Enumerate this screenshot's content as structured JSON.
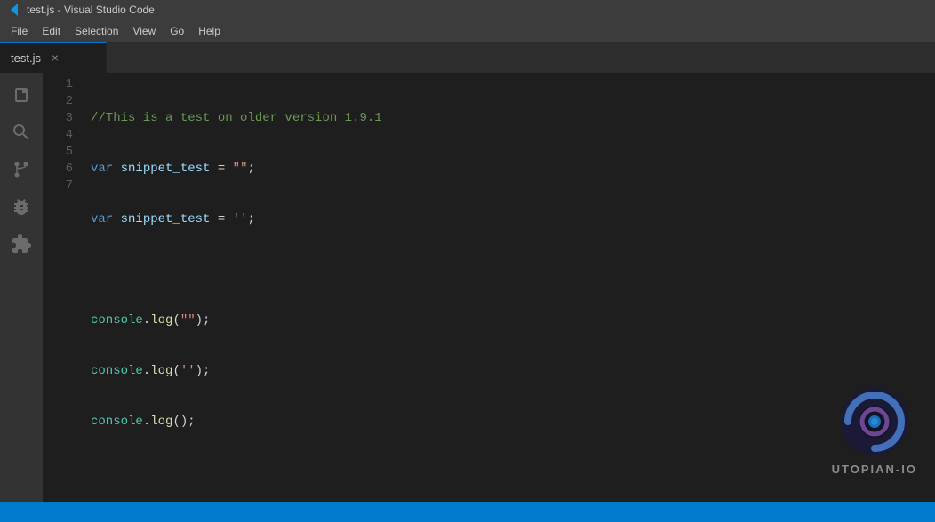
{
  "titleBar": {
    "title": "test.js - Visual Studio Code"
  },
  "menuBar": {
    "items": [
      "File",
      "Edit",
      "Selection",
      "View",
      "Go",
      "Help"
    ]
  },
  "tabs": [
    {
      "label": "test.js",
      "active": true
    }
  ],
  "activityBar": {
    "icons": [
      {
        "name": "files-icon",
        "symbol": "⎙",
        "active": false
      },
      {
        "name": "search-icon",
        "symbol": "🔍",
        "active": false
      },
      {
        "name": "source-control-icon",
        "symbol": "⎇",
        "active": false
      },
      {
        "name": "debug-icon",
        "symbol": "⬤",
        "active": false
      },
      {
        "name": "extensions-icon",
        "symbol": "⊞",
        "active": false
      }
    ]
  },
  "editor": {
    "filename": "test.js",
    "lines": [
      {
        "num": "1",
        "tokens": [
          {
            "type": "comment",
            "text": "//This is a test on older version 1.9.1"
          }
        ]
      },
      {
        "num": "2",
        "tokens": [
          {
            "type": "keyword",
            "text": "var"
          },
          {
            "type": "space",
            "text": " "
          },
          {
            "type": "variable",
            "text": "snippet_test"
          },
          {
            "type": "punct",
            "text": " = "
          },
          {
            "type": "string-dq",
            "text": "\"\""
          },
          {
            "type": "punct",
            "text": ";"
          }
        ]
      },
      {
        "num": "3",
        "tokens": [
          {
            "type": "keyword",
            "text": "var"
          },
          {
            "type": "space",
            "text": " "
          },
          {
            "type": "variable",
            "text": "snippet_test"
          },
          {
            "type": "punct",
            "text": " = "
          },
          {
            "type": "string-sq",
            "text": "''"
          },
          {
            "type": "punct",
            "text": ";"
          }
        ]
      },
      {
        "num": "4",
        "tokens": []
      },
      {
        "num": "5",
        "tokens": [
          {
            "type": "obj",
            "text": "console"
          },
          {
            "type": "punct",
            "text": "."
          },
          {
            "type": "func",
            "text": "log"
          },
          {
            "type": "punct",
            "text": "("
          },
          {
            "type": "string-dq",
            "text": "\"\""
          },
          {
            "type": "punct",
            "text": ");"
          }
        ]
      },
      {
        "num": "6",
        "tokens": [
          {
            "type": "obj",
            "text": "console"
          },
          {
            "type": "punct",
            "text": "."
          },
          {
            "type": "func",
            "text": "log"
          },
          {
            "type": "punct",
            "text": "("
          },
          {
            "type": "string-sq",
            "text": "''"
          },
          {
            "type": "punct",
            "text": ");"
          }
        ]
      },
      {
        "num": "7",
        "tokens": [
          {
            "type": "obj",
            "text": "console"
          },
          {
            "type": "punct",
            "text": "."
          },
          {
            "type": "func",
            "text": "log"
          },
          {
            "type": "punct",
            "text": "();"
          }
        ]
      }
    ]
  },
  "watermark": {
    "text": "UTOPIAN-IO"
  },
  "statusBar": {
    "text": ""
  }
}
